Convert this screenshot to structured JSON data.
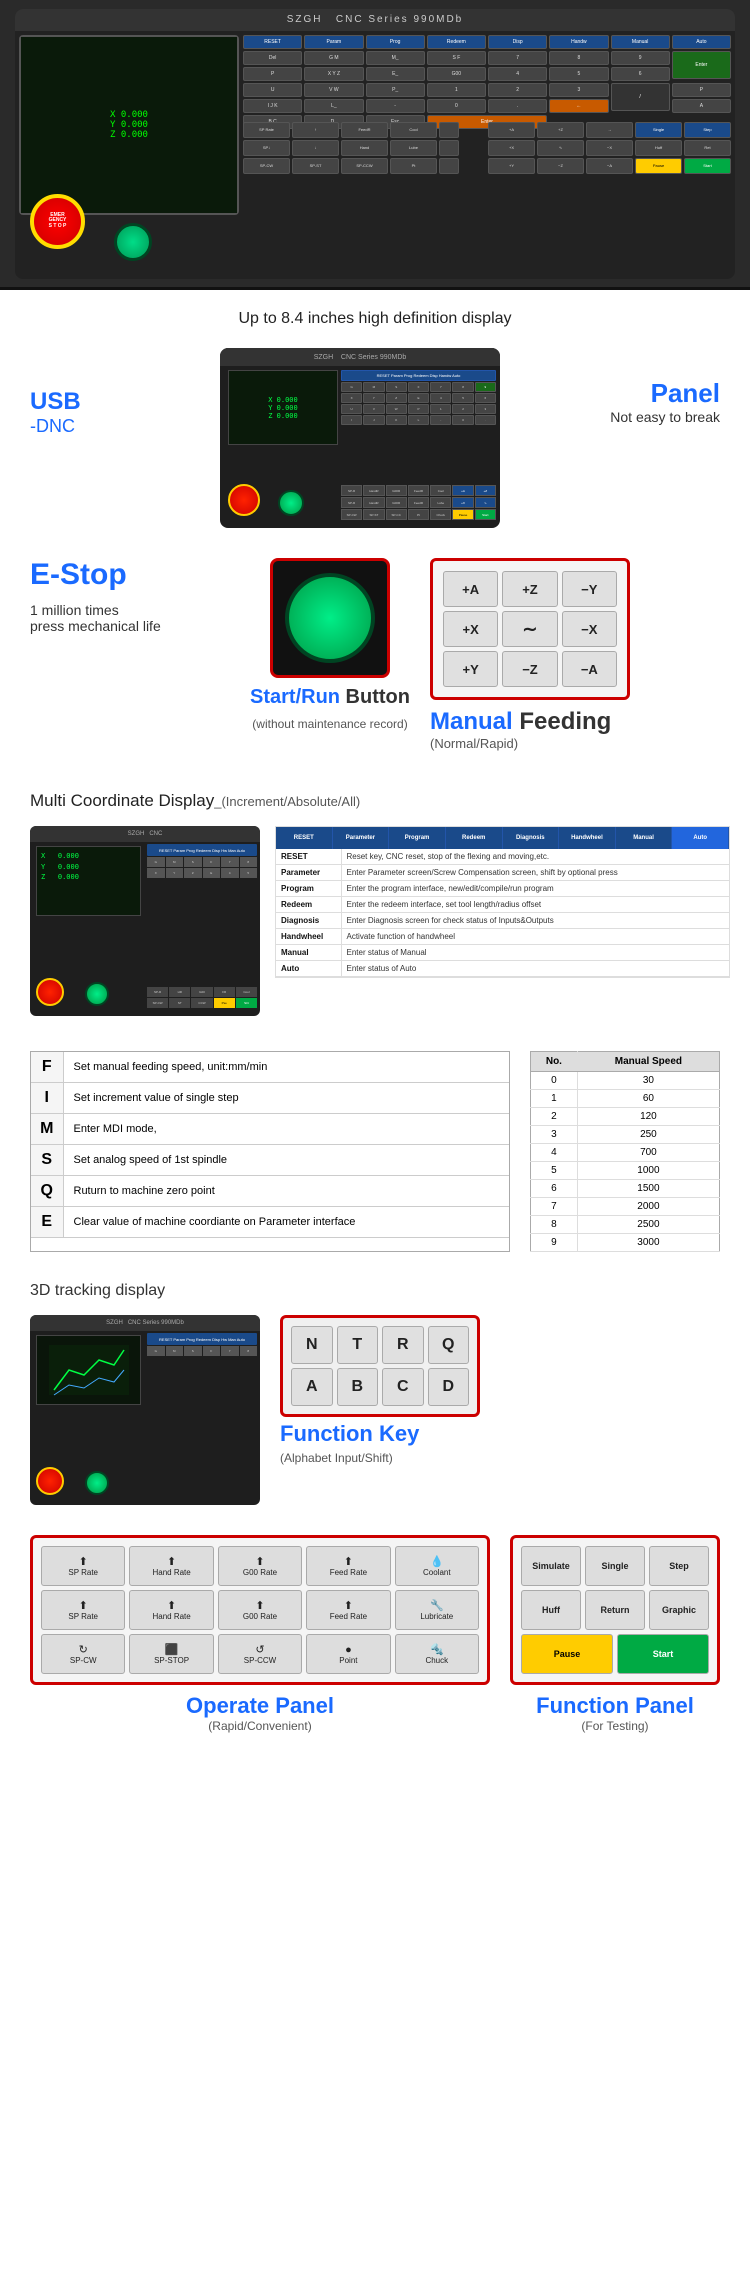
{
  "header": {
    "brand": "SZGH",
    "model": "CNC Series 990MDb"
  },
  "section_display": {
    "title": "Up to 8.4 inches high definition display",
    "usb_label": "USB",
    "usb_sub": "-DNC",
    "panel_label": "Panel",
    "panel_sub": "Not easy to break"
  },
  "section_estop": {
    "title": "E-Stop",
    "desc_line1": "1 million times",
    "desc_line2": "press mechanical life",
    "startrun_label": "Start/Run",
    "startrun_suffix": " Button",
    "startrun_sub": "(without maintenance record)",
    "manual_title": "Manual",
    "manual_suffix": " Feeding",
    "manual_sub": "(Normal/Rapid)",
    "manual_keys": [
      "+A",
      "+Z",
      "−Y",
      "+X",
      "∼",
      "−X",
      "+Y",
      "−Z",
      "−A"
    ]
  },
  "section_coord": {
    "title": "Multi Coordinate Display",
    "title_sub": "_(Increment/Absolute/All)",
    "screen_lines": [
      "X  0.000",
      "Y  0.000",
      "Z  0.000"
    ],
    "top_buttons": [
      "RESET",
      "Parameter",
      "Program",
      "Redeem",
      "Diagnosis",
      "Handwheel",
      "Manual",
      "Auto"
    ],
    "table_rows": [
      [
        "RESET",
        "Reset key, CNC reset, stop of the flexing and moving,etc."
      ],
      [
        "Parameter",
        "Enter Parameter screen/Screw Compensation screen, shift by optional press"
      ],
      [
        "Program",
        "Enter the program interface, new/edit/compile/run program"
      ],
      [
        "Redeem",
        "Enter the redeem interface, set tool length/radius offset"
      ],
      [
        "Diagnosis",
        "Enter Diagnosis screen for check status of Inputs&Outputs"
      ],
      [
        "Handwheel",
        "Activate function of handwheel"
      ],
      [
        "Manual",
        "Enter status of Manual"
      ],
      [
        "Auto",
        "Enter status of Auto"
      ]
    ]
  },
  "section_fkeys": {
    "rows": [
      [
        "F",
        "Set manual feeding speed, unit:mm/min"
      ],
      [
        "I",
        "Set increment value of single step"
      ],
      [
        "M",
        "Enter MDI mode,"
      ],
      [
        "S",
        "Set analog speed of 1st spindle"
      ],
      [
        "Q",
        "Ruturn to machine zero point"
      ],
      [
        "E",
        "Clear value of machine coordiante on Parameter interface"
      ]
    ],
    "manual_speed_title": "Manual Speed",
    "speed_table_header": [
      "No.",
      "Manual Speed"
    ],
    "speed_table": [
      [
        "0",
        "30"
      ],
      [
        "1",
        "60"
      ],
      [
        "2",
        "120"
      ],
      [
        "3",
        "250"
      ],
      [
        "4",
        "700"
      ],
      [
        "5",
        "1000"
      ],
      [
        "6",
        "1500"
      ],
      [
        "7",
        "2000"
      ],
      [
        "8",
        "2500"
      ],
      [
        "9",
        "3000"
      ]
    ]
  },
  "section_3d": {
    "title": "3D tracking display",
    "function_key_title": "Function Key",
    "function_key_sub": "(Alphabet Input/Shift)",
    "function_keys": [
      "N",
      "T",
      "R",
      "Q",
      "A",
      "B",
      "C",
      "D"
    ]
  },
  "section_operate": {
    "operate_title": "Operate Panel",
    "operate_sub": "(Rapid/Convenient)",
    "function_panel_title": "Function Panel",
    "function_panel_sub": "(For Testing)",
    "operate_row1": [
      "SP Rate",
      "Hand Rate",
      "G00 Rate",
      "Feed Rate",
      "Coolant"
    ],
    "operate_row2": [
      "SP Rate",
      "Hand Rate",
      "G00 Rate",
      "Feed Rate",
      "Lubricate"
    ],
    "operate_row3": [
      "SP-CW",
      "SP-STOP",
      "SP-CCW",
      "Point",
      "Chuck"
    ],
    "function_top": [
      "Simulate",
      "Single",
      "Step"
    ],
    "function_bottom": [
      "Huff",
      "Return",
      "Graphic",
      "Pause",
      "Start"
    ]
  },
  "colors": {
    "blue_accent": "#1a6aff",
    "red_border": "#cc0000",
    "cyan": "#00cccc",
    "yellow": "#ffcc00",
    "green_start": "#00aa44"
  }
}
